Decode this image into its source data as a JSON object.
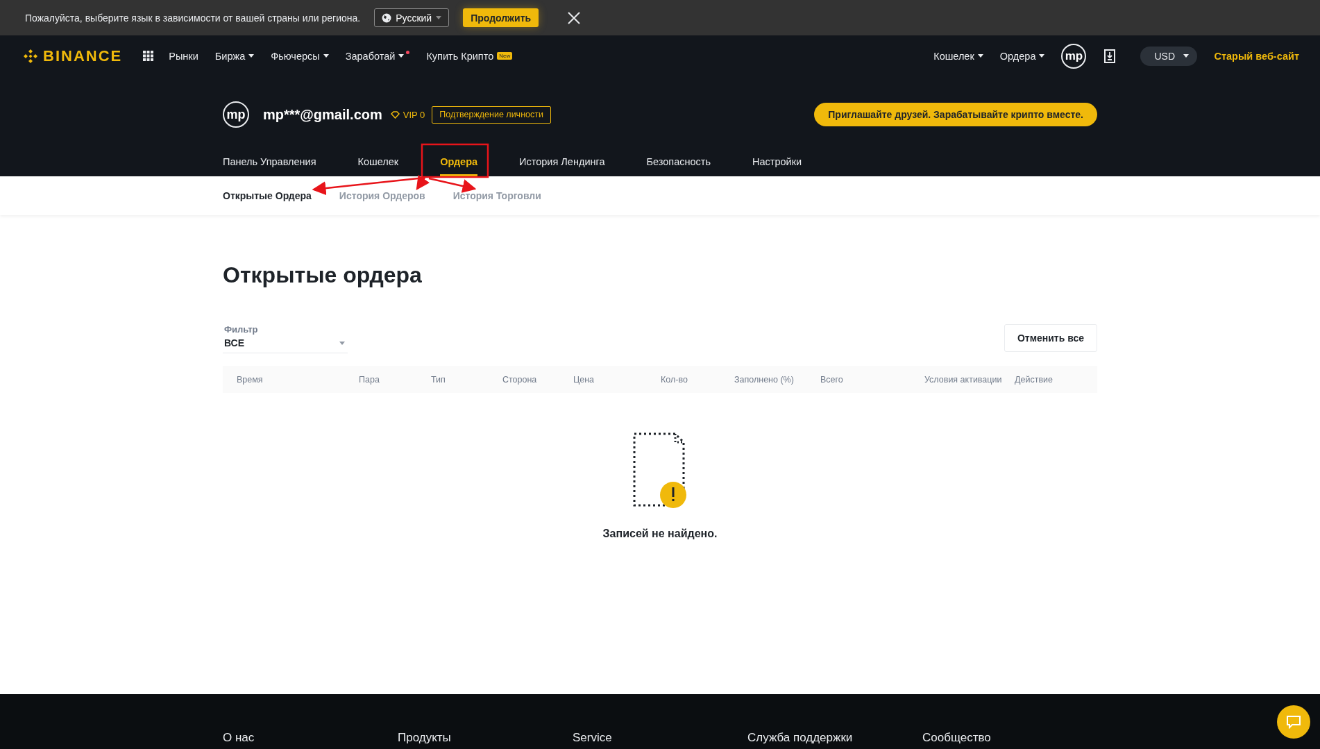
{
  "language_banner": {
    "message": "Пожалуйста, выберите язык в зависимости от вашей страны или региона.",
    "language": "Русский",
    "continue": "Продолжить"
  },
  "header": {
    "logo": "BINANCE",
    "nav": [
      {
        "label": "Рынки",
        "caret": false,
        "dot": false
      },
      {
        "label": "Биржа",
        "caret": true,
        "dot": false
      },
      {
        "label": "Фьючерсы",
        "caret": true,
        "dot": false
      },
      {
        "label": "Заработай",
        "caret": true,
        "dot": true
      },
      {
        "label": "Купить Крипто",
        "caret": false,
        "dot": false,
        "badge": "New"
      }
    ],
    "right_nav": [
      {
        "label": "Кошелек",
        "caret": true
      },
      {
        "label": "Ордера",
        "caret": true
      }
    ],
    "avatar": "mp",
    "currency": "USD",
    "old_site": "Старый веб-сайт"
  },
  "profile": {
    "avatar": "mp",
    "email": "mp***@gmail.com",
    "vip": "VIP 0",
    "verify": "Подтверждение личности",
    "invite": "Приглашайте друзей. Зарабатывайте крипто вместе."
  },
  "tabs": [
    {
      "label": "Панель Управления",
      "selected": false
    },
    {
      "label": "Кошелек",
      "selected": false
    },
    {
      "label": "Ордера",
      "selected": true
    },
    {
      "label": "История Лендинга",
      "selected": false
    },
    {
      "label": "Безопасность",
      "selected": false
    },
    {
      "label": "Настройки",
      "selected": false
    }
  ],
  "subtabs": [
    {
      "label": "Открытые Ордера",
      "selected": true
    },
    {
      "label": "История Ордеров",
      "selected": false
    },
    {
      "label": "История Торговли",
      "selected": false
    }
  ],
  "page_title": "Открытые ордера",
  "filter": {
    "label": "Фильтр",
    "value": "ВСЕ"
  },
  "cancel_all": "Отменить все",
  "table": {
    "columns": [
      "Время",
      "Пара",
      "Тип",
      "Сторона",
      "Цена",
      "Кол-во",
      "Заполнено (%)",
      "Всего",
      "Условия активации",
      "Действие"
    ],
    "empty": "Записей не найдено."
  },
  "footer": {
    "columns": [
      "О нас",
      "Продукты",
      "Service",
      "Служба поддержки",
      "Сообщество"
    ]
  }
}
